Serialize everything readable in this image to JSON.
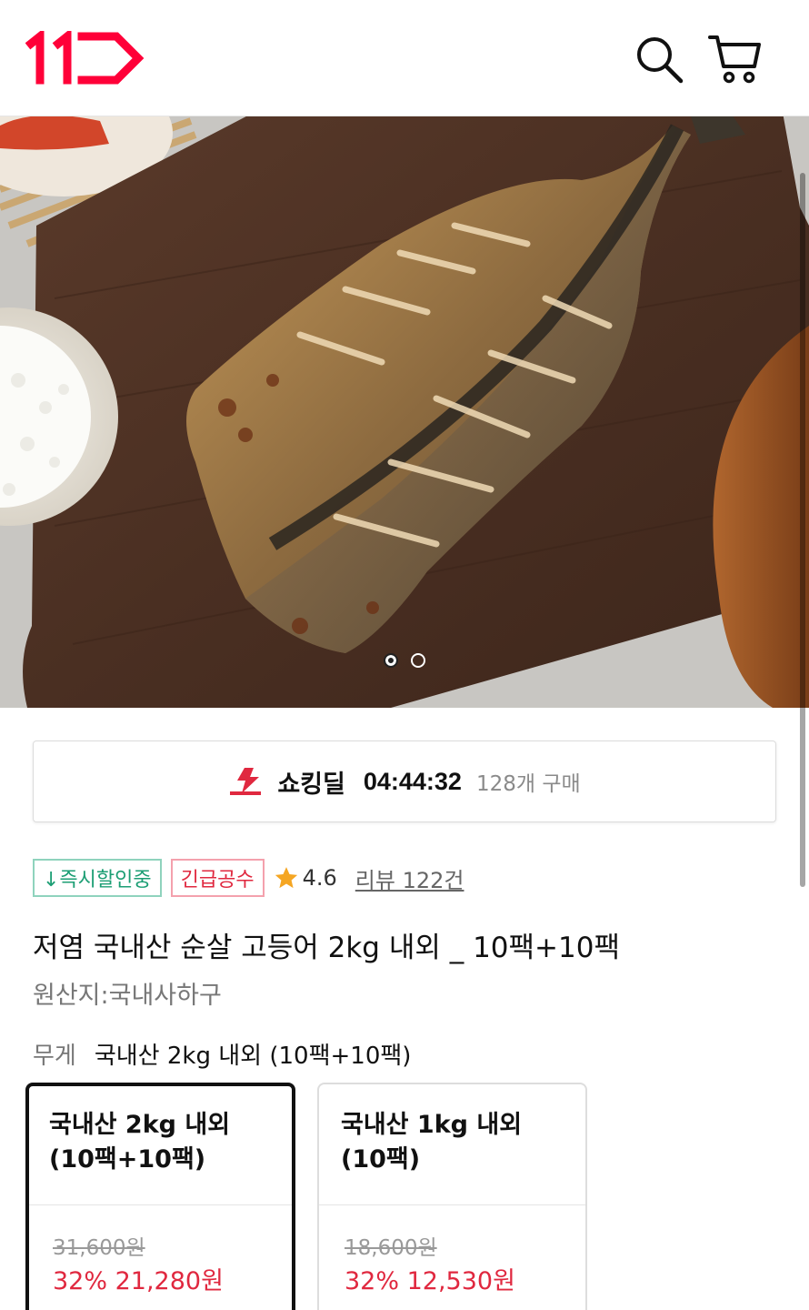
{
  "header": {
    "logo_text": "11",
    "brand_color": "#ff0038",
    "search_icon": "search-icon",
    "cart_icon": "cart-icon"
  },
  "gallery": {
    "image_subject": "grilled mackerel on wooden board",
    "slide_count": 2,
    "active_index": 0
  },
  "deal": {
    "icon": "shocking-deal-icon",
    "title": "쇼킹딜",
    "timer": "04:44:32",
    "purchase_count": "128개 구매"
  },
  "badges": {
    "instant_discount": "↓즉시할인중",
    "urgent": "긴급공수",
    "rating": "4.6",
    "review_link": "리뷰 122건"
  },
  "product": {
    "title": "저염 국내산 순살 고등어 2kg 내외 _ 10팩+10팩",
    "origin": "원산지:국내사하구"
  },
  "weight": {
    "label": "무게",
    "selected_value": "국내산 2kg 내외 (10팩+10팩)"
  },
  "options": [
    {
      "name": "국내산 2kg 내외 (10팩+10팩)",
      "original_price": "31,600원",
      "sale_price": "32% 21,280원",
      "selected": true
    },
    {
      "name": "국내산 1kg 내외 (10팩)",
      "original_price": "18,600원",
      "sale_price": "32% 12,530원",
      "selected": false
    }
  ],
  "colors": {
    "accent_red": "#e0283f",
    "green": "#1c9e74",
    "star": "#f5a623"
  }
}
